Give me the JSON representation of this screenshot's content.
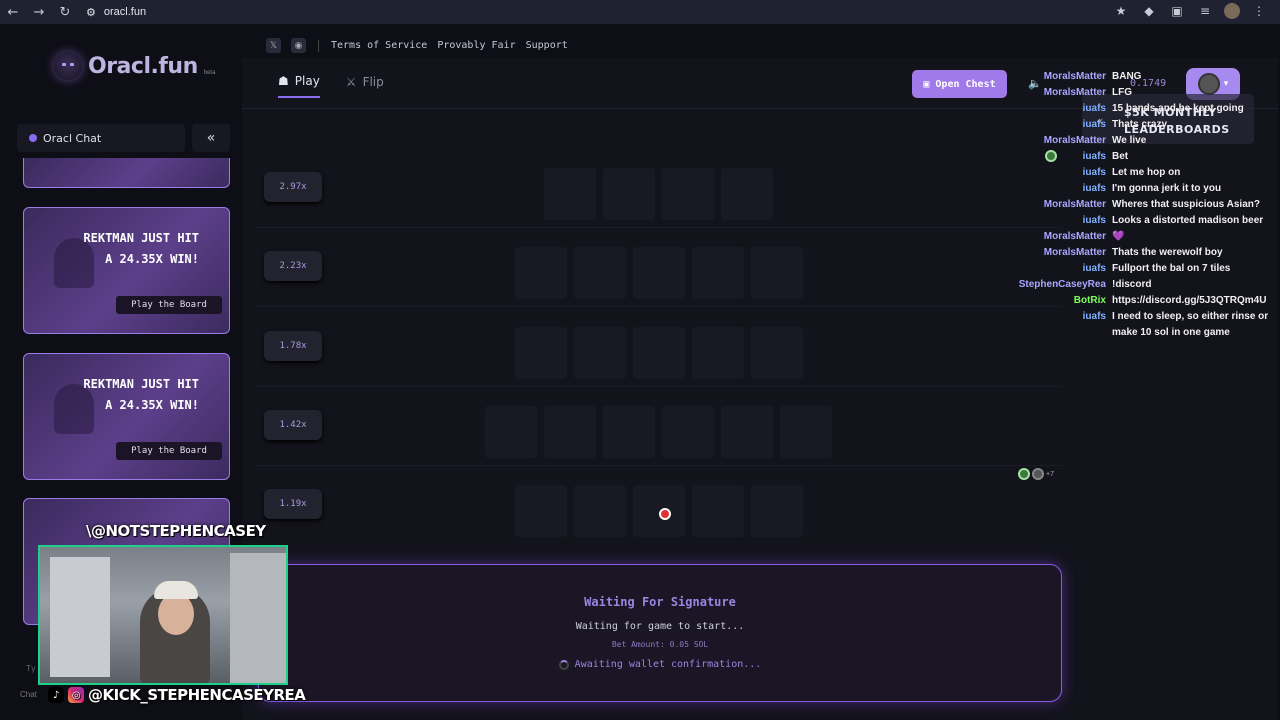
{
  "browser": {
    "url": "oracl.fun",
    "back_icon": "←",
    "forward_icon": "→",
    "reload_icon": "↻"
  },
  "app": {
    "logo_text": "Oracl.fun",
    "logo_beta": "beta",
    "top_links": [
      "Terms of Service",
      "Provably Fair",
      "Support"
    ],
    "tabs": [
      {
        "label": "Play",
        "icon": "ghost-icon",
        "active": true
      },
      {
        "label": "Flip",
        "icon": "swords-icon",
        "active": false
      }
    ],
    "open_chest_label": "Open Chest",
    "balance": "0.1749",
    "accent_color": "#9f7ae8"
  },
  "sidebar": {
    "title": "Oracl Chat",
    "cards": [
      {
        "text": "REKTMAN JUST HIT A 24.35X WIN!",
        "button": "Play the Board"
      },
      {
        "text": "REKTMAN JUST HIT A 24.35X WIN!",
        "button": "Play the Board"
      }
    ],
    "chat_input_label": "Chat",
    "input_partial": "Ty"
  },
  "board": {
    "rows": [
      {
        "multiplier": "2.97x",
        "tiles": 4
      },
      {
        "multiplier": "2.23x",
        "tiles": 5
      },
      {
        "multiplier": "1.78x",
        "tiles": 5
      },
      {
        "multiplier": "1.42x",
        "tiles": 6
      },
      {
        "multiplier": "1.19x",
        "tiles": 5
      }
    ],
    "players_extra": "+7"
  },
  "waiting": {
    "title": "Waiting For Signature",
    "subtitle": "Waiting for game to start...",
    "bet": "Bet Amount: 0.05 SOL",
    "awaiting": "Awaiting wallet confirmation..."
  },
  "leaderboard": {
    "line1": "MONTHLY",
    "line2": "LEADERBOARDS",
    "prefix1": "$5K",
    "prefix2": ""
  },
  "stream_chat": [
    {
      "user": "MoralsMatter",
      "color": "#a7a7ff",
      "text": "BANG"
    },
    {
      "user": "MoralsMatter",
      "color": "#a7a7ff",
      "text": "LFG"
    },
    {
      "user": "iuafs",
      "color": "#7fb0ff",
      "text": "15 bands and he kept going"
    },
    {
      "user": "iuafs",
      "color": "#7fb0ff",
      "text": "Thats crazy"
    },
    {
      "user": "MoralsMatter",
      "color": "#a7a7ff",
      "text": "We live"
    },
    {
      "user": "iuafs",
      "color": "#7fb0ff",
      "text": "Bet"
    },
    {
      "user": "iuafs",
      "color": "#7fb0ff",
      "text": "Let me hop on"
    },
    {
      "user": "iuafs",
      "color": "#7fb0ff",
      "text": "I'm gonna jerk it to you"
    },
    {
      "user": "MoralsMatter",
      "color": "#a7a7ff",
      "text": "Wheres that suspicious Asian?"
    },
    {
      "user": "iuafs",
      "color": "#7fb0ff",
      "text": "Looks a distorted madison beer"
    },
    {
      "user": "MoralsMatter",
      "color": "#a7a7ff",
      "text": "💜"
    },
    {
      "user": "MoralsMatter",
      "color": "#a7a7ff",
      "text": "Thats the werewolf boy"
    },
    {
      "user": "iuafs",
      "color": "#7fb0ff",
      "text": "Fullport the bal on 7 tiles"
    },
    {
      "user": "StephenCaseyRea",
      "color": "#a7a7ff",
      "text": "!discord"
    },
    {
      "user": "BotRix",
      "color": "#7cff5a",
      "text": "https://discord.gg/5J3QTRQm4U"
    },
    {
      "user": "iuafs",
      "color": "#7fb0ff",
      "text": "I need to sleep, so either rinse or"
    },
    {
      "user": "",
      "color": "#7fb0ff",
      "text": "make 10 sol in one game"
    }
  ],
  "overlay": {
    "cam_handle": "\\@NOTSTEPHENCASEY",
    "kick_handle": "@KICK_STEPHENCASEYREA"
  }
}
